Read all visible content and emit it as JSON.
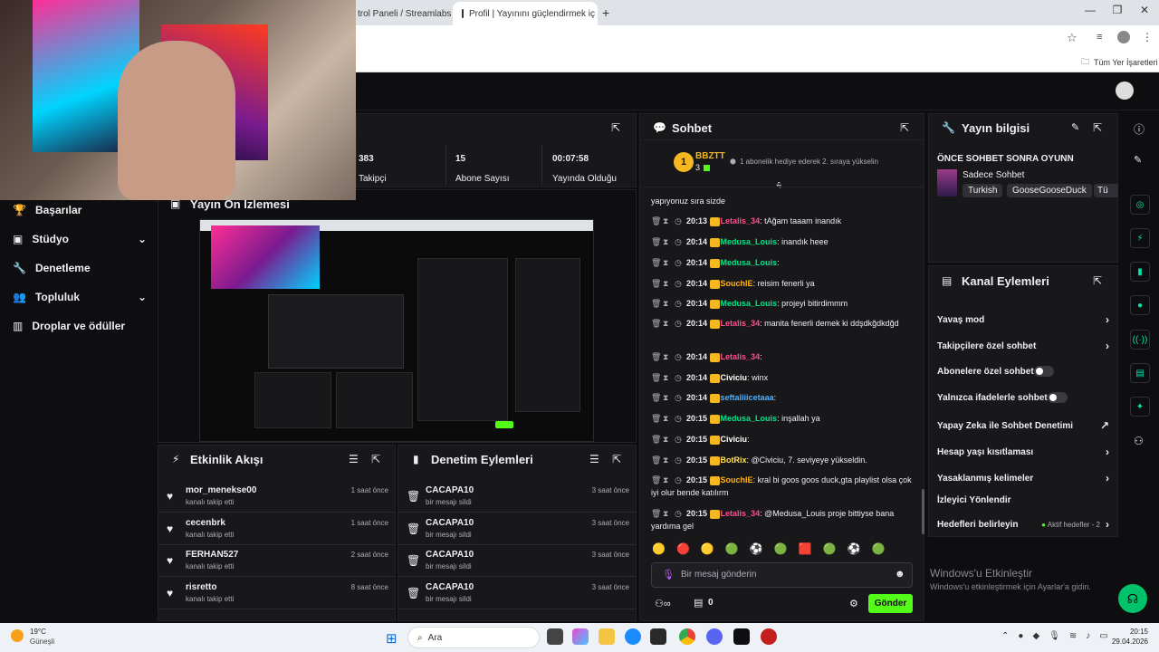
{
  "browser": {
    "tabs": [
      {
        "title": "trol Paneli / Streamlabs",
        "close": "×"
      },
      {
        "title": "Profil | Yayınını güçlendirmek iç",
        "close": "×"
      }
    ],
    "new_tab": "+",
    "window_controls": {
      "minimize": "—",
      "maximize": "❐",
      "close": "✕"
    },
    "bookmarks_label": "Tüm Yer İşaretleri"
  },
  "sidebar": {
    "items": [
      {
        "label": "Başarılar",
        "icon": "trophy-icon",
        "chev": ""
      },
      {
        "label": "Stüdyo",
        "icon": "studio-icon",
        "chev": "⌄"
      },
      {
        "label": "Denetleme",
        "icon": "wrench-icon",
        "chev": ""
      },
      {
        "label": "Topluluk",
        "icon": "community-icon",
        "chev": "⌄"
      },
      {
        "label": "Droplar ve ödüller",
        "icon": "drops-icon",
        "chev": ""
      }
    ]
  },
  "stats": {
    "followers_value": "383",
    "followers_label": "Takipçi",
    "subs_value": "15",
    "subs_label": "Abone Sayısı",
    "uptime_value": "00:07:58",
    "uptime_label": "Yayında Olduğu"
  },
  "preview": {
    "title": "Yayın Ön İzlemesi"
  },
  "activity": {
    "title": "Etkinlik Akışı",
    "items": [
      {
        "name": "mor_menekse00",
        "sub": "kanalı takip etti",
        "time": "1 saat önce"
      },
      {
        "name": "cecenbrk",
        "sub": "kanalı takip etti",
        "time": "1 saat önce"
      },
      {
        "name": "FERHAN527",
        "sub": "kanalı takip etti",
        "time": "2 saat önce"
      },
      {
        "name": "risretto",
        "sub": "kanalı takip etti",
        "time": "8 saat önce"
      }
    ]
  },
  "modlog": {
    "title": "Denetim Eylemleri",
    "items": [
      {
        "name": "CACAPA10",
        "sub": "bir mesajı sildi",
        "time": "3 saat önce"
      },
      {
        "name": "CACAPA10",
        "sub": "bir mesajı sildi",
        "time": "3 saat önce"
      },
      {
        "name": "CACAPA10",
        "sub": "bir mesajı sildi",
        "time": "3 saat önce"
      },
      {
        "name": "CACAPA10",
        "sub": "bir mesajı sildi",
        "time": "3 saat önce"
      }
    ]
  },
  "chat": {
    "title": "Sohbet",
    "leader_rank": "1",
    "leader_name": "BBZTT",
    "leader_count": "3",
    "leader_note": "1 abonelik hediye ederek 2. sıraya yükselin",
    "partial_line": "yapıyonuz sıra sizde",
    "messages": [
      {
        "time": "20:13",
        "user": "Letalis_34",
        "color": "#ff4f8b",
        "text": ": tAğam taaam inandık"
      },
      {
        "time": "20:14",
        "user": "Medusa_Louis",
        "color": "#00e58a",
        "text": ": inandık heee"
      },
      {
        "time": "20:14",
        "user": "Medusa_Louis",
        "color": "#00e58a",
        "text": ":"
      },
      {
        "time": "20:14",
        "user": "SouchIE",
        "color": "#ffb31a",
        "text": ": reisim fenerli ya"
      },
      {
        "time": "20:14",
        "user": "Medusa_Louis",
        "color": "#00e58a",
        "text": ": projeyi bitirdimmm"
      },
      {
        "time": "20:14",
        "user": "Letalis_34",
        "color": "#ff4f8b",
        "text": ": manita fenerli demek ki ddşdkğdkdğd"
      },
      {
        "time": "20:14",
        "user": "Letalis_34",
        "color": "#ff4f8b",
        "text": ":"
      },
      {
        "time": "20:14",
        "user": "Civiciu",
        "color": "#ffffff",
        "text": ": winx"
      },
      {
        "time": "20:14",
        "user": "seftaliiicetaaa",
        "color": "#4fb0ff",
        "text": ":"
      },
      {
        "time": "20:15",
        "user": "Medusa_Louis",
        "color": "#00e58a",
        "text": ": inşallah ya"
      },
      {
        "time": "20:15",
        "user": "Civiciu",
        "color": "#ffffff",
        "text": ":"
      },
      {
        "time": "20:15",
        "user": "BotRix",
        "color": "#ffe14d",
        "text": ": @Civiciu, 7. seviyeye yükseldin."
      },
      {
        "time": "20:15",
        "user": "SouchIE",
        "color": "#ffb31a",
        "text": ": kral bi goos goos duck,gta playlist olsa çok iyi olur bende katılırm"
      },
      {
        "time": "20:15",
        "user": "Letalis_34",
        "color": "#ff4f8b",
        "text": ": @Medusa_Louis proje bittiyse bana yardıma gel"
      }
    ],
    "input_placeholder": "Bir mesaj gönderin",
    "points": "0",
    "send_label": "Gönder"
  },
  "streaminfo": {
    "title": "Yayın bilgisi",
    "stream_title": "ÖNCE SOHBET SONRA OYUNN",
    "category": "Sadece Sohbet",
    "tags": [
      "Turkish",
      "GooseGooseDuck",
      "Tü"
    ]
  },
  "channel_actions": {
    "title": "Kanal Eylemleri",
    "items": [
      {
        "label": "Yavaş mod",
        "right": "›"
      },
      {
        "label": "Takipçilere özel sohbet",
        "right": "›"
      },
      {
        "label": "Abonelere özel sohbet",
        "right": "toggle"
      },
      {
        "label": "Yalnızca ifadelerle sohbet",
        "right": "toggle"
      },
      {
        "label": "Yapay Zeka ile Sohbet Denetimi",
        "right": "↗"
      },
      {
        "label": "Hesap yaşı kısıtlaması",
        "right": "›"
      },
      {
        "label": "Yasaklanmış kelimeler",
        "right": "›"
      },
      {
        "label": "İzleyici Yönlendir",
        "right": ""
      },
      {
        "label": "Hedefleri belirleyin",
        "right": "›"
      }
    ],
    "goals_active": "Aktif hedefler - 2"
  },
  "watermark": {
    "title": "Windows'u Etkinleştir",
    "sub": "Windows'u etkinleştirmek için Ayarlar'a gidin."
  },
  "taskbar": {
    "weather_temp": "19°C",
    "weather_desc": "Güneşli",
    "search": "Ara",
    "time": "20:15",
    "date": "29.04.2026"
  }
}
